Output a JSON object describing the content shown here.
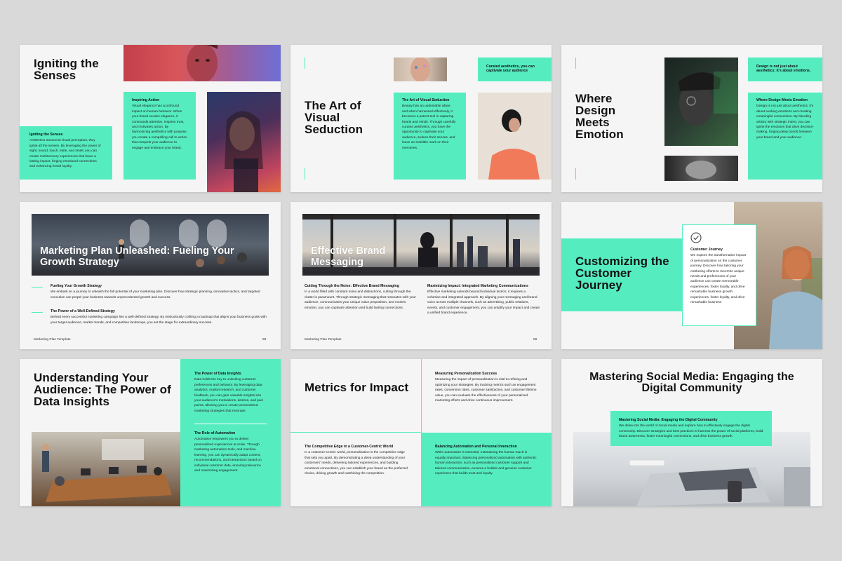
{
  "colors": {
    "accent": "#55edc0",
    "bg": "#f5f5f5",
    "page": "#d9d9d9"
  },
  "s1": {
    "title": "Igniting the Senses",
    "box1_h": "Inspiring Action",
    "box1_p": "Visual elegance has a profound impact on human behavior. When your brand exudes elegance, it commands attention, inspires trust, and motivates action. By harmonizing aesthetics with purpose, you create a compelling call to action that compels your audience to engage and embrace your brand.",
    "box2_h": "Igniting the Senses",
    "box2_p": "Aesthetics transcend visual perception; they ignite all the senses. By leveraging the power of sight, sound, touch, taste, and smell, you can create multisensory experiences that leave a lasting impact, forging emotional connections and enhancing brand loyalty."
  },
  "s2": {
    "title": "The Art of Visual Seduction",
    "tag": "Curated aesthetics, you can captivate your audience",
    "box_h": "The Art of Visual Seduction",
    "box_p": "Beauty has an undeniable allure, and when harnessed effectively, it becomes a potent tool in capturing hearts and minds. Through carefully curated aesthetics, you have the opportunity to captivate your audience, seduce their senses, and leave an indelible mark on their memories."
  },
  "s3": {
    "title": "Where Design Meets Emotion",
    "tag": "Design is not just about aesthetics; it's about emotions.",
    "box_h": "Where Design Meets Emotion",
    "box_p": "Design is not just about aesthetics; it's about evoking emotions and creating meaningful connections. By blending artistry with strategic intent, you can ignite the emotions that drive decision-making, forging deep bonds between your brand and your audience."
  },
  "s4": {
    "title": "Marketing Plan Unleashed: Fueling Your Growth Strategy",
    "h1": "Fueling Your Growth Strategy",
    "p1": "We embark on a journey to unleash the full potential of your marketing plan. Discover how strategic planning, innovative tactics, and targeted execution can propel your business towards unprecedented growth and success.",
    "h2": "The Power of a Well-Defined Strategy",
    "p2": "Behind every successful marketing campaign lies a well-defined strategy. By meticulously crafting a roadmap that aligns your business goals with your target audience, market trends, and competitive landscape, you set the stage for extraordinary success.",
    "footer": "Marketing Plan Template",
    "page": "58"
  },
  "s5": {
    "title": "Effective Brand Messaging",
    "h1": "Cutting Through the Noise: Effective Brand Messaging",
    "p1": "In a world filled with constant noise and distractions, cutting through the clutter is paramount. Through strategic messaging that resonates with your audience, communicates your unique value proposition, and evokes emotion, you can captivate attention and build lasting connections.",
    "h2": "Maximizing Impact: Integrated Marketing Communications",
    "p2": "Effective marketing extends beyond individual tactics; it requires a cohesive and integrated approach. By aligning your messaging and brand voice across multiple channels, such as advertising, public relations, events, and customer engagement, you can amplify your impact and create a unified brand experience.",
    "footer": "Marketing Plan Template",
    "page": "59"
  },
  "s6": {
    "title": "Customizing the Customer Journey",
    "box_h": "Customer Journey",
    "box_p": "We explore the transformative impact of personalization on the customer journey. Discover how tailoring your marketing efforts to meet the unique needs and preferences of your audience can create memorable experiences, foster loyalty, and drive remarkable business growth. experiences, foster loyalty, and drive remarkable business"
  },
  "s7": {
    "title": "Understanding Your Audience: The Power of Data Insights",
    "h1": "The Power of Data Insights",
    "p1": "Data holds the key to unlocking customer preferences and behavior. By leveraging data analytics, market research, and customer feedback, you can gain valuable insights into your audience's motivations, desires, and pain points, allowing you to create personalized marketing strategies that resonate.",
    "h2": "The Role of Automation",
    "p2": "Automation empowers you to deliver personalized experiences at scale. Through marketing automation tools, and machine learning, you can dynamically adapt content, recommendations, and interactions based on individual customer data, ensuring relevance and maximizing engagement."
  },
  "s8": {
    "title": "Metrics for Impact",
    "h1": "Measuring Personalization Success",
    "p1": "Measuring the impact of personalization is vital to refining and optimizing your strategies. By tracking metrics such as engagement rates, conversion rates, customer satisfaction, and customer lifetime value, you can evaluate the effectiveness of your personalized marketing efforts and drive continuous improvement.",
    "h2": "The Competitive Edge in a Customer-Centric World",
    "p2": "In a customer-centric world, personalization is the competitive edge that sets you apart. By demonstrating a deep understanding of your customers' needs, delivering tailored experiences, and building emotional connections, you can establish your brand as the preferred choice, driving growth and outshining the competition.",
    "h3": "Balancing Automation and Personal Interaction",
    "p3": "While automation is essential, maintaining the human touch is equally important. Balancing personalized automation with authentic human interaction, such as personalized customer support and tailored communication, ensures a holistic and genuine customer experience that builds trust and loyalty."
  },
  "s9": {
    "title": "Mastering Social Media: Engaging the Digital Community",
    "box_h": "Mastering Social Media: Engaging the Digital Community",
    "box_p": "We delve into the world of social media and explore how to effectively engage the digital community. Discover strategies and best practices to harness the power of social platforms, build brand awareness, foster meaningful connections, and drive business growth."
  }
}
